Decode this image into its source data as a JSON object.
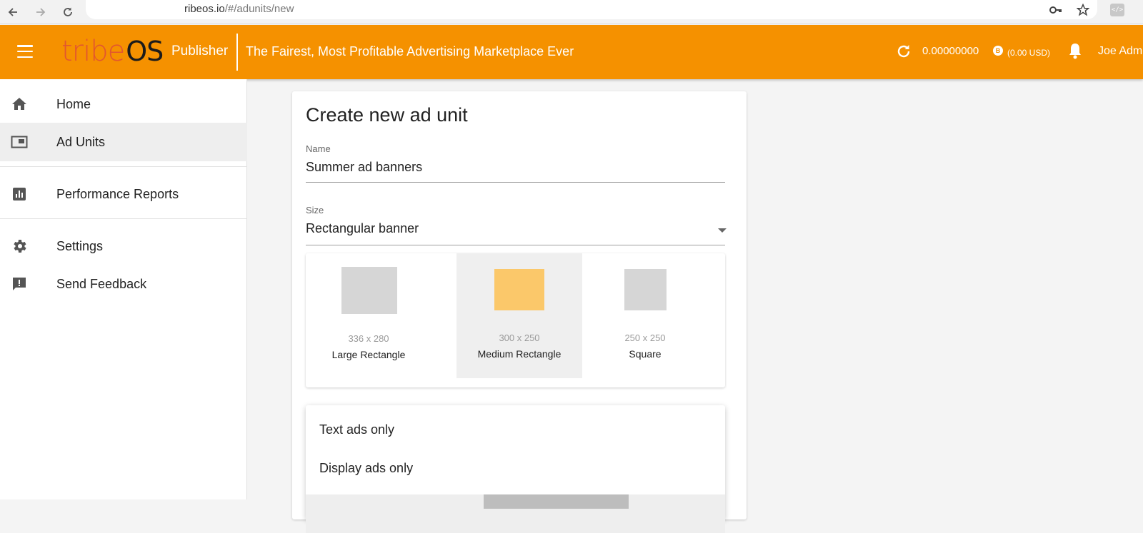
{
  "browser": {
    "url_host": "ribeos.io",
    "url_path": "/#/adunits/new"
  },
  "header": {
    "logo_tribe": "tribe",
    "logo_os": "OS",
    "product": "Publisher",
    "tagline": "The Fairest, Most Profitable Advertising Marketplace Ever",
    "balance": "0.00000000",
    "coin_symbol": "B",
    "usd": "(0.00 USD)",
    "user": "Joe Adm"
  },
  "sidebar": {
    "items": [
      {
        "label": "Home",
        "icon": "home-icon"
      },
      {
        "label": "Ad Units",
        "icon": "ad-units-icon",
        "active": true
      },
      {
        "label": "Performance Reports",
        "icon": "bar-chart-icon"
      },
      {
        "label": "Settings",
        "icon": "gear-icon"
      },
      {
        "label": "Send Feedback",
        "icon": "feedback-icon"
      }
    ]
  },
  "form": {
    "title": "Create new ad unit",
    "name_label": "Name",
    "name_value": "Summer ad banners",
    "size_label": "Size",
    "size_value": "Rectangular banner",
    "sizes": [
      {
        "dim": "336 x 280",
        "name": "Large Rectangle"
      },
      {
        "dim": "300 x 250",
        "name": "Medium Rectangle",
        "selected": true
      },
      {
        "dim": "250 x 250",
        "name": "Square"
      }
    ],
    "ad_type_options": [
      "Text ads only",
      "Display ads only"
    ]
  },
  "colors": {
    "brand_orange": "#f59100",
    "selected_thumb": "#fbc86a",
    "logo_red": "#e2562f"
  }
}
